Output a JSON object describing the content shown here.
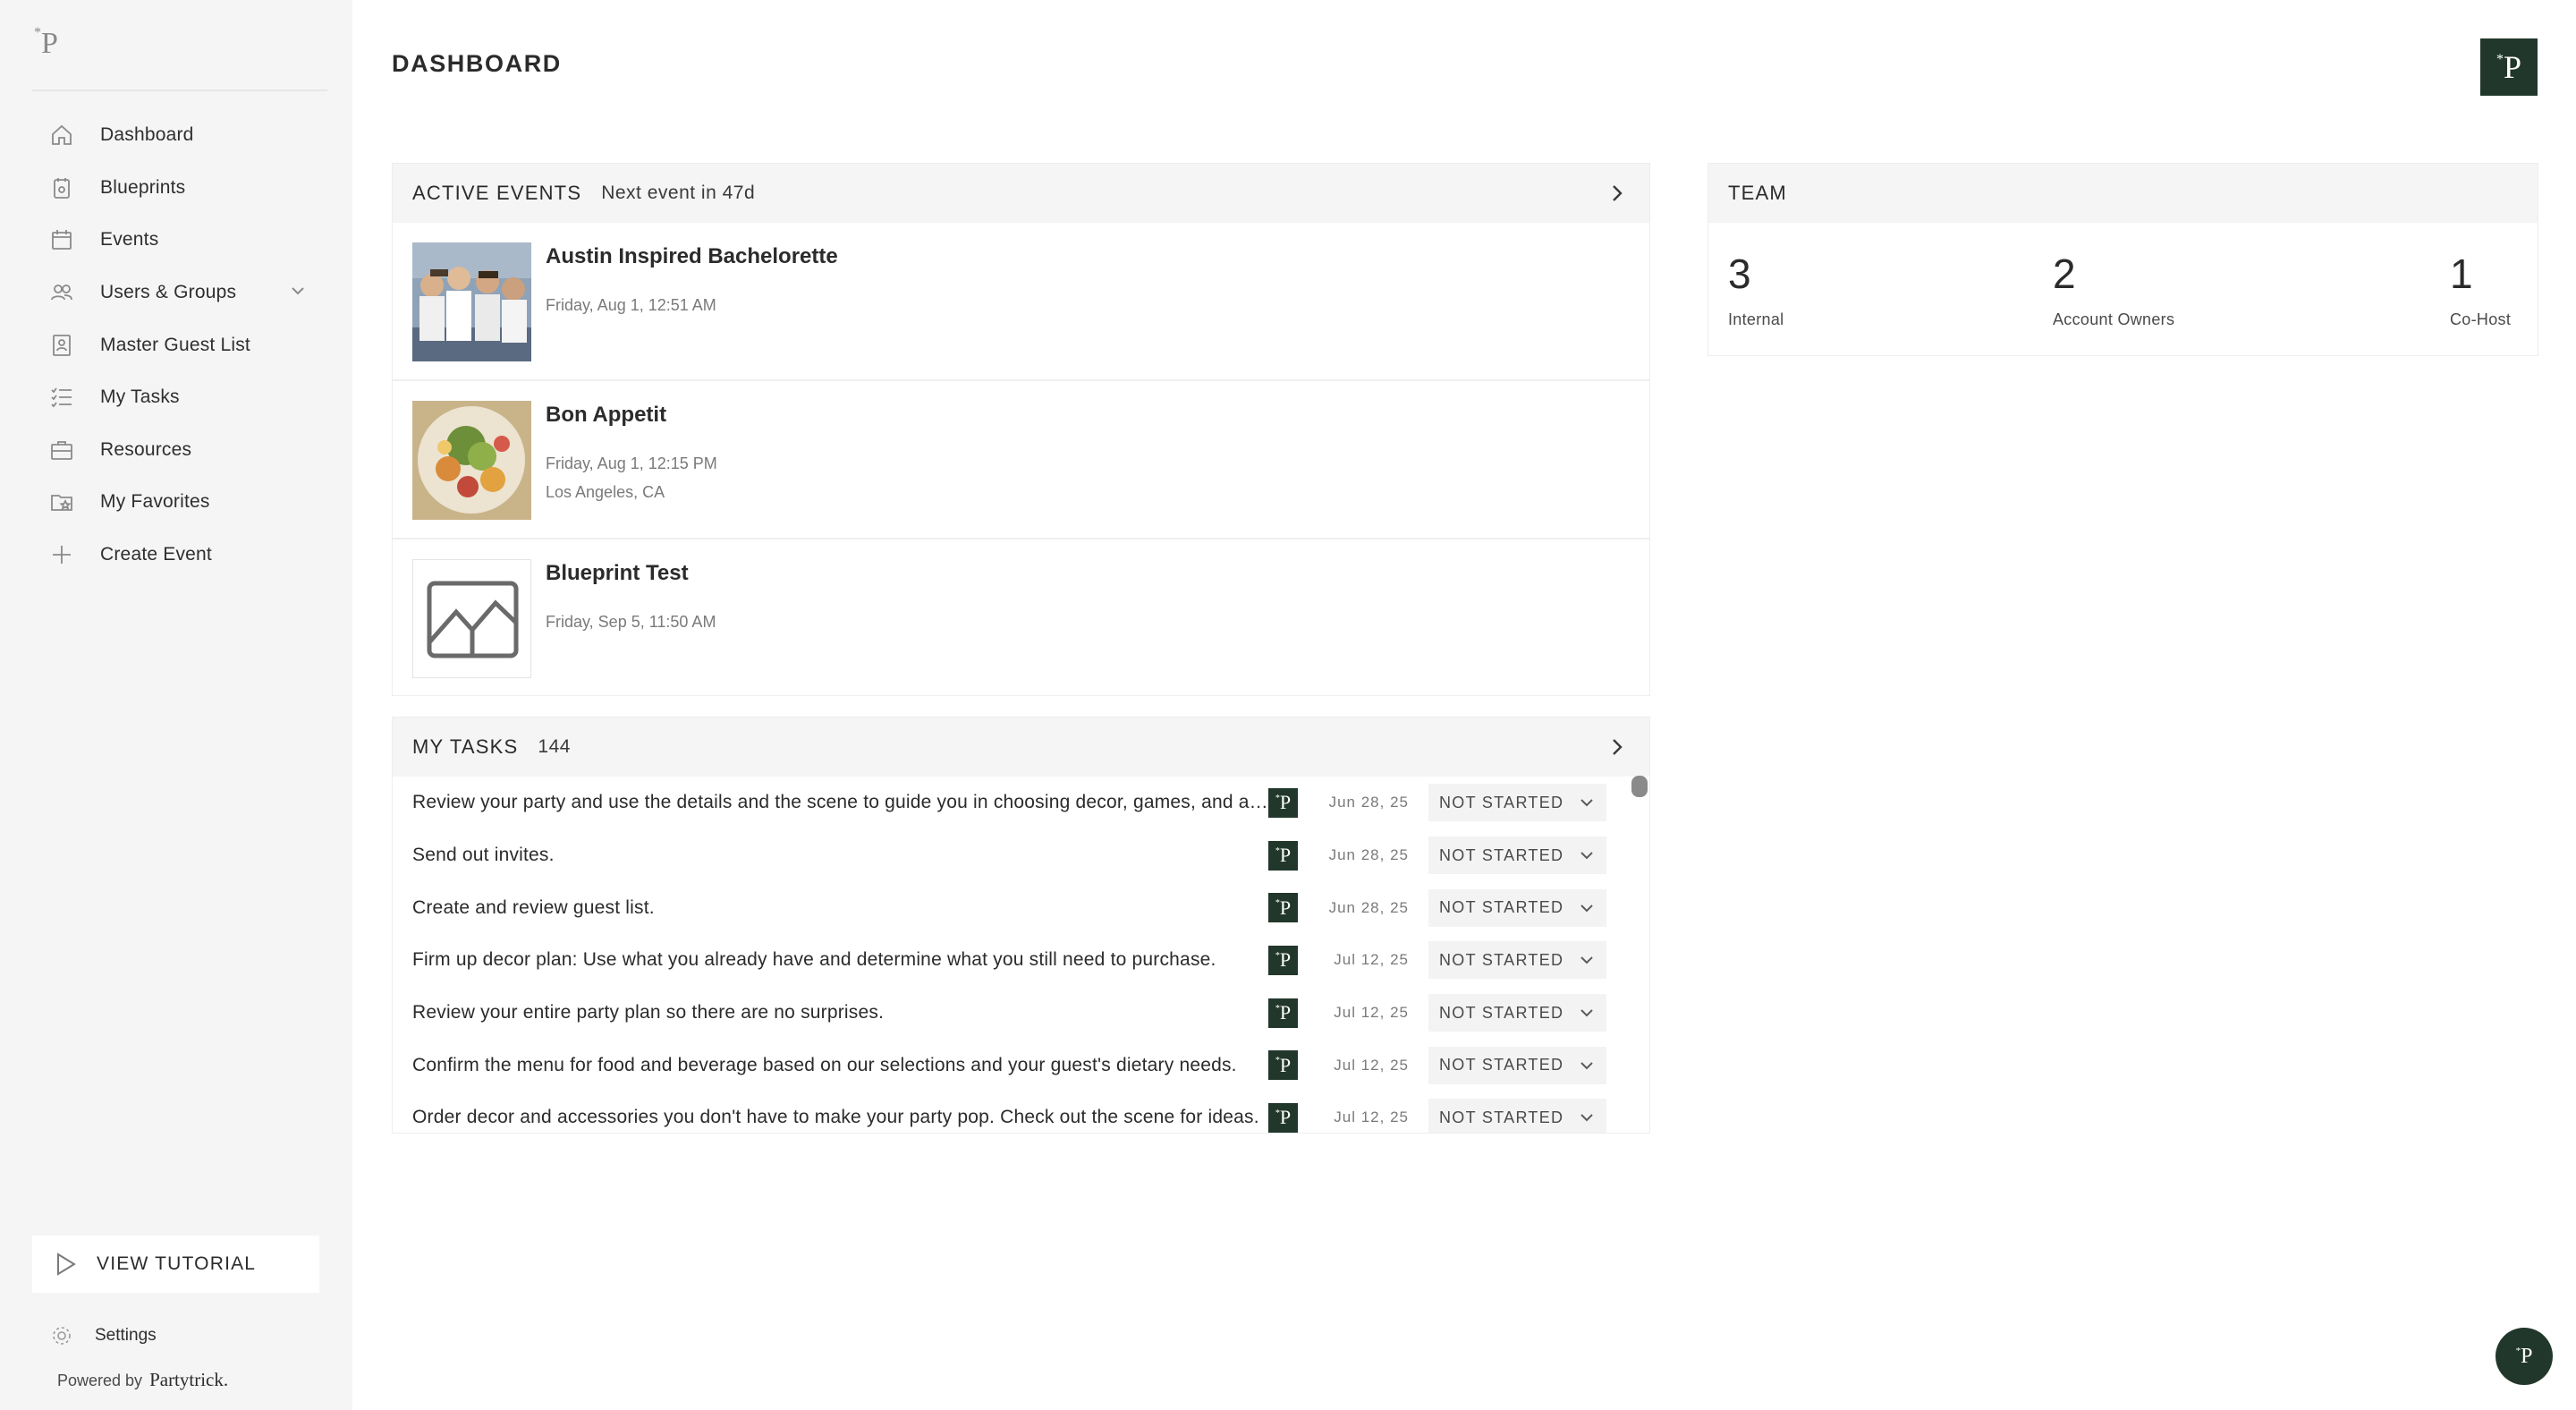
{
  "brand": {
    "logo_letter": "P",
    "logo_mark": "*"
  },
  "sidebar": {
    "items": [
      {
        "label": "Dashboard",
        "icon": "home-icon"
      },
      {
        "label": "Blueprints",
        "icon": "blueprint-icon"
      },
      {
        "label": "Events",
        "icon": "calendar-icon"
      },
      {
        "label": "Users & Groups",
        "icon": "users-icon",
        "has_chevron": true
      },
      {
        "label": "Master Guest List",
        "icon": "guest-list-icon"
      },
      {
        "label": "My Tasks",
        "icon": "tasks-icon"
      },
      {
        "label": "Resources",
        "icon": "briefcase-icon"
      },
      {
        "label": "My Favorites",
        "icon": "favorites-folder-icon"
      },
      {
        "label": "Create Event",
        "icon": "plus-icon"
      }
    ],
    "tutorial_label": "VIEW TUTORIAL",
    "settings_label": "Settings",
    "powered_by": "Powered by",
    "powered_brand": "Partytrick."
  },
  "header": {
    "title": "DASHBOARD"
  },
  "active_events": {
    "title": "ACTIVE EVENTS",
    "subtitle": "Next event in 47d",
    "events": [
      {
        "name": "Austin Inspired Bachelorette",
        "date": "Friday, Aug 1, 12:51 AM",
        "location": ""
      },
      {
        "name": "Bon Appetit",
        "date": "Friday, Aug 1, 12:15 PM",
        "location": "Los Angeles, CA"
      },
      {
        "name": "Blueprint Test",
        "date": "Friday, Sep 5, 11:50 AM",
        "location": ""
      }
    ]
  },
  "team": {
    "title": "TEAM",
    "stats": [
      {
        "value": "3",
        "label": "Internal"
      },
      {
        "value": "2",
        "label": "Account Owners"
      },
      {
        "value": "1",
        "label": "Co-Host"
      }
    ]
  },
  "my_tasks": {
    "title": "MY TASKS",
    "count": "144",
    "tasks": [
      {
        "text": "Review your party and use the details and the scene to guide you in choosing decor, games, and activities.",
        "date": "Jun 28, 25",
        "status": "NOT STARTED"
      },
      {
        "text": "Send out invites.",
        "date": "Jun 28, 25",
        "status": "NOT STARTED"
      },
      {
        "text": "Create and review guest list.",
        "date": "Jun 28, 25",
        "status": "NOT STARTED"
      },
      {
        "text": "Firm up decor plan: Use what you already have and determine what you still need to purchase.",
        "date": "Jul 12, 25",
        "status": "NOT STARTED"
      },
      {
        "text": "Review your entire party plan so there are no surprises.",
        "date": "Jul 12, 25",
        "status": "NOT STARTED"
      },
      {
        "text": "Confirm the menu for food and beverage based on our selections and your guest's dietary needs.",
        "date": "Jul 12, 25",
        "status": "NOT STARTED"
      },
      {
        "text": "Order decor and accessories you don't have to make your party pop. Check out the scene for ideas.",
        "date": "Jul 12, 25",
        "status": "NOT STARTED"
      }
    ]
  },
  "colors": {
    "brand_green": "#22372b",
    "sidebar_bg": "#f5f5f5",
    "panel_head_bg": "#f5f5f5"
  }
}
